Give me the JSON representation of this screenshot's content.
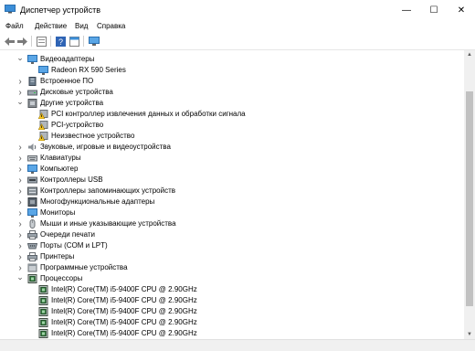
{
  "window": {
    "title": "Диспетчер устройств",
    "minimize": "—",
    "maximize": "☐",
    "close": "✕"
  },
  "menu": [
    "Файл",
    "Действие",
    "Вид",
    "Справка"
  ],
  "toolbar_icons": [
    "back-arrow-icon",
    "forward-arrow-icon",
    "properties-icon",
    "help-icon",
    "properties-panel-icon",
    "monitor-scan-icon"
  ],
  "tree": [
    {
      "label": "Видеоадаптеры",
      "level": 1,
      "state": "expanded",
      "icon": "display-adapter-icon"
    },
    {
      "label": "Radeon RX 590 Series",
      "level": 2,
      "state": "leaf",
      "icon": "display-adapter-icon"
    },
    {
      "label": "Встроенное ПО",
      "level": 1,
      "state": "collapsed",
      "icon": "firmware-icon"
    },
    {
      "label": "Дисковые устройства",
      "level": 1,
      "state": "collapsed",
      "icon": "disk-drive-icon"
    },
    {
      "label": "Другие устройства",
      "level": 1,
      "state": "expanded",
      "icon": "other-devices-icon"
    },
    {
      "label": "PCI контроллер извлечения данных и обработки сигнала",
      "level": 2,
      "state": "leaf",
      "icon": "unknown-device-warning-icon"
    },
    {
      "label": "PCI-устройство",
      "level": 2,
      "state": "leaf",
      "icon": "unknown-device-warning-icon"
    },
    {
      "label": "Неизвестное устройство",
      "level": 2,
      "state": "leaf",
      "icon": "unknown-device-warning-icon"
    },
    {
      "label": "Звуковые, игровые и видеоустройства",
      "level": 1,
      "state": "collapsed",
      "icon": "speaker-icon"
    },
    {
      "label": "Клавиатуры",
      "level": 1,
      "state": "collapsed",
      "icon": "keyboard-icon"
    },
    {
      "label": "Компьютер",
      "level": 1,
      "state": "collapsed",
      "icon": "computer-icon"
    },
    {
      "label": "Контроллеры USB",
      "level": 1,
      "state": "collapsed",
      "icon": "usb-icon"
    },
    {
      "label": "Контроллеры запоминающих устройств",
      "level": 1,
      "state": "collapsed",
      "icon": "storage-controller-icon"
    },
    {
      "label": "Многофункциональные адаптеры",
      "level": 1,
      "state": "collapsed",
      "icon": "multifunction-adapter-icon"
    },
    {
      "label": "Мониторы",
      "level": 1,
      "state": "collapsed",
      "icon": "monitor-icon"
    },
    {
      "label": "Мыши и иные указывающие устройства",
      "level": 1,
      "state": "collapsed",
      "icon": "mouse-icon"
    },
    {
      "label": "Очереди печати",
      "level": 1,
      "state": "collapsed",
      "icon": "print-queue-icon"
    },
    {
      "label": "Порты (COM и LPT)",
      "level": 1,
      "state": "collapsed",
      "icon": "port-icon"
    },
    {
      "label": "Принтеры",
      "level": 1,
      "state": "collapsed",
      "icon": "printer-icon"
    },
    {
      "label": "Программные устройства",
      "level": 1,
      "state": "collapsed",
      "icon": "software-device-icon"
    },
    {
      "label": "Процессоры",
      "level": 1,
      "state": "expanded",
      "icon": "processor-icon"
    },
    {
      "label": "Intel(R) Core(TM) i5-9400F CPU @ 2.90GHz",
      "level": 2,
      "state": "leaf",
      "icon": "processor-icon"
    },
    {
      "label": "Intel(R) Core(TM) i5-9400F CPU @ 2.90GHz",
      "level": 2,
      "state": "leaf",
      "icon": "processor-icon"
    },
    {
      "label": "Intel(R) Core(TM) i5-9400F CPU @ 2.90GHz",
      "level": 2,
      "state": "leaf",
      "icon": "processor-icon"
    },
    {
      "label": "Intel(R) Core(TM) i5-9400F CPU @ 2.90GHz",
      "level": 2,
      "state": "leaf",
      "icon": "processor-icon"
    },
    {
      "label": "Intel(R) Core(TM) i5-9400F CPU @ 2.90GHz",
      "level": 2,
      "state": "leaf",
      "icon": "processor-icon"
    },
    {
      "label": "Intel(R) Core(TM) i5-9400F CPU @ 2.90GHz",
      "level": 2,
      "state": "leaf",
      "icon": "processor-icon"
    }
  ]
}
